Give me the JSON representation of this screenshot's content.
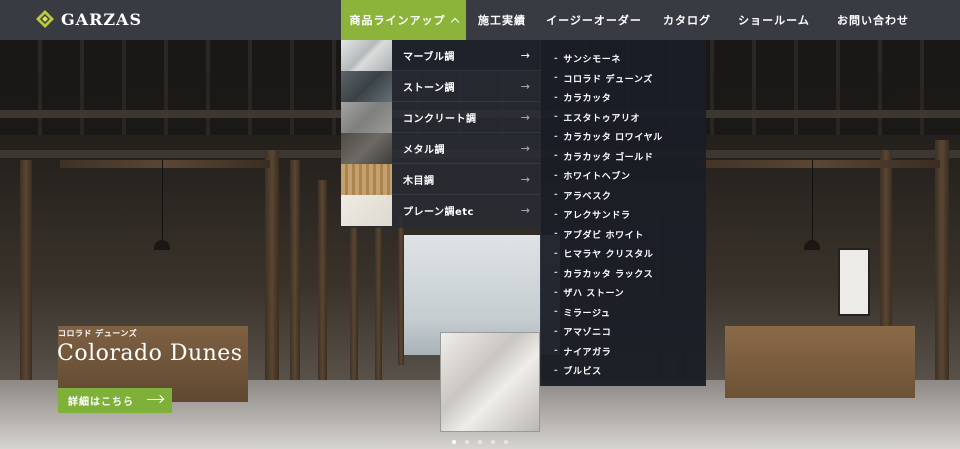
{
  "brand": {
    "name": "GARZAS",
    "logo_icon": "garzas-diamond-logo-icon",
    "accent": "#8cb43a"
  },
  "nav": [
    {
      "label": "商品ラインアップ",
      "active": true,
      "icon": "chevron-up-icon"
    },
    {
      "label": "施工実績"
    },
    {
      "label": "イージーオーダー"
    },
    {
      "label": "カタログ"
    },
    {
      "label": "ショールーム"
    },
    {
      "label": "お問い合わせ"
    }
  ],
  "categories": [
    {
      "label": "マーブル調",
      "swatch": "#c9cccd",
      "icon": "arrow-right-icon"
    },
    {
      "label": "ストーン調",
      "swatch": "#4a5256",
      "icon": "arrow-right-icon"
    },
    {
      "label": "コンクリート調",
      "swatch": "#8d8e8c",
      "icon": "arrow-right-icon"
    },
    {
      "label": "メタル調",
      "swatch": "#5f5d59",
      "icon": "arrow-right-icon"
    },
    {
      "label": "木目調",
      "swatch": "#b79463",
      "icon": "arrow-right-icon"
    },
    {
      "label": "プレーン調etc",
      "swatch": "#e6e3db",
      "icon": "arrow-right-icon"
    }
  ],
  "subitems": [
    "サンシモーネ",
    "コロラド デューンズ",
    "カラカッタ",
    "エスタトゥアリオ",
    "カラカッタ ロワイヤル",
    "カラカッタ ゴールド",
    "ホワイトヘブン",
    "アラベスク",
    "アレクサンドラ",
    "アブダビ ホワイト",
    "ヒマラヤ クリスタル",
    "カラカッタ ラックス",
    "ザハ ストーン",
    "ミラージュ",
    "アマゾニコ",
    "ナイアガラ",
    "ブルビス"
  ],
  "sub_prefix": "-",
  "hero": {
    "kana": "コロラド デューンズ",
    "title": "Colorado Dunes",
    "cta_label": "詳細はこちら",
    "cta_icon": "long-arrow-right-icon",
    "slide_count": 5,
    "active_slide": 1
  }
}
